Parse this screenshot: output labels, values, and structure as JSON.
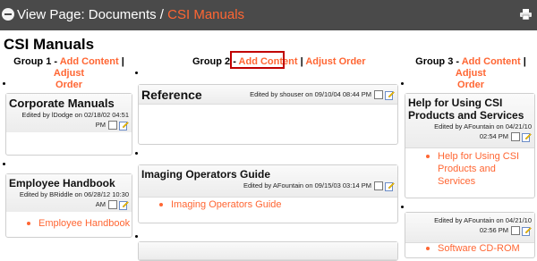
{
  "header": {
    "prefix": "View Page: Documents / ",
    "current": "CSI Manuals"
  },
  "page_title": "CSI Manuals",
  "groups": [
    {
      "label": "Group 1 - ",
      "add": "Add Content",
      "sep": " | ",
      "adjust_a": "Adjust",
      "adjust_b": "Order"
    },
    {
      "label": "Group 2 - ",
      "add": "Add Content",
      "sep": " | ",
      "adjust": "Adjust Order"
    },
    {
      "label": "Group 3 - ",
      "add": "Add Content",
      "sep": " | ",
      "adjust_a": "Adjust",
      "adjust_b": "Order"
    }
  ],
  "cards": {
    "corporate": {
      "title": "Corporate Manuals",
      "meta1": "Edited by lDodge on 02/18/02 04:51",
      "meta2": "PM"
    },
    "employee": {
      "title": "Employee Handbook",
      "meta1": "Edited by BRiddle on 06/28/12 10:30",
      "meta2": "AM",
      "link": "Employee Handbook"
    },
    "reference": {
      "title": "Reference",
      "meta": "Edited by shouser on 09/10/04 08:44 PM"
    },
    "imaging": {
      "title": "Imaging Operators Guide",
      "meta": "Edited by AFountain on 09/15/03 03:14 PM",
      "link": "Imaging Operators Guide"
    },
    "help": {
      "title_a": "Help for Using CSI",
      "title_b": "Products and Services",
      "meta1": "Edited by AFountain on 04/21/10",
      "meta2": "02:54 PM",
      "link_a": "Help for Using CSI",
      "link_b": "Products and",
      "link_c": "Services"
    },
    "software": {
      "meta1": "Edited by AFountain on 04/21/10",
      "meta2": "02:56 PM",
      "link": "Software CD-ROM"
    }
  }
}
